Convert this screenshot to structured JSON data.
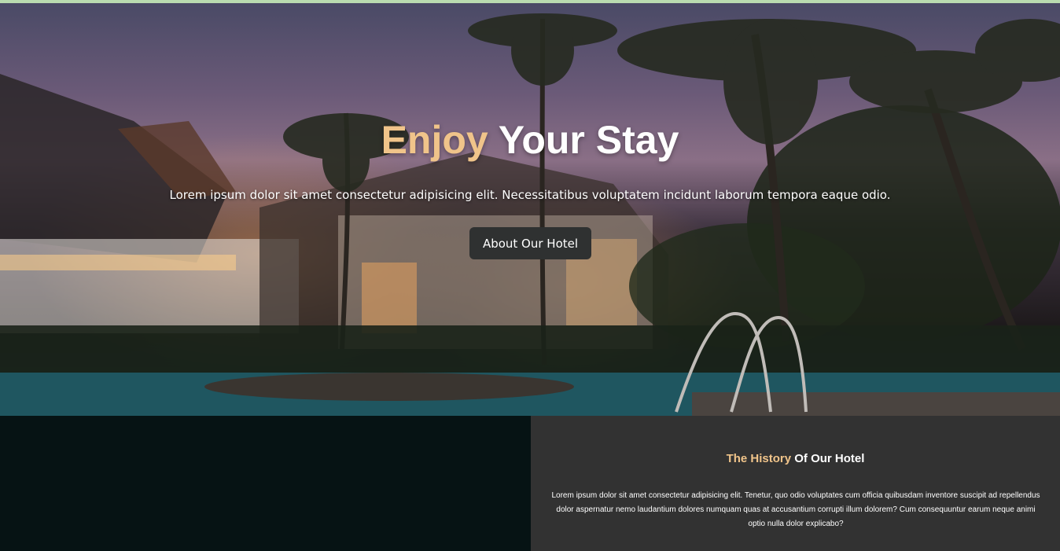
{
  "hero": {
    "title_accent": "Enjoy",
    "title_rest": " Your Stay",
    "subtitle": "Lorem ipsum dolor sit amet consectetur adipisicing elit. Necessitatibus voluptatem incidunt laborum tempora eaque odio.",
    "button_label": "About Our Hotel"
  },
  "history": {
    "title_accent": "The History",
    "title_rest": " Of Our Hotel",
    "text": "Lorem ipsum dolor sit amet consectetur adipisicing elit. Tenetur, quo odio voluptates cum officia quibusdam inventore suscipit ad repellendus dolor aspernatur nemo laudantium dolores numquam quas at accusantium corrupti illum dolorem? Cum consequuntur earum neque animi optio nulla dolor explicabo?"
  },
  "colors": {
    "accent": "#f0c48a",
    "button_bg": "#2f3131",
    "history_bg": "#323232",
    "left_panel_bg": "#061314"
  }
}
